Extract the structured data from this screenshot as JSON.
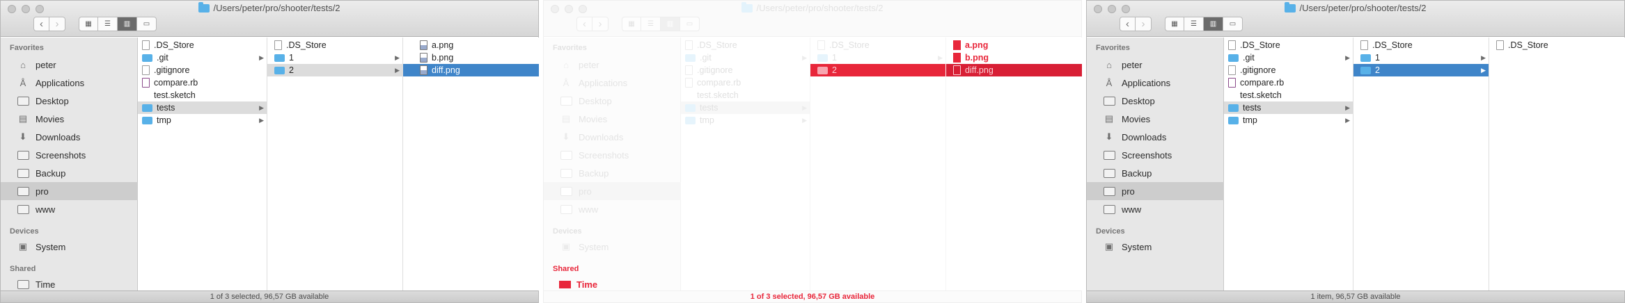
{
  "window": {
    "title": "/Users/peter/pro/shooter/tests/2",
    "nav_back": "‹",
    "nav_forward": "›"
  },
  "sidebar": {
    "favorites_header": "Favorites",
    "favorites": [
      {
        "label": "peter",
        "icon": "home-icon"
      },
      {
        "label": "Applications",
        "icon": "applications-icon"
      },
      {
        "label": "Desktop",
        "icon": "desktop-icon"
      },
      {
        "label": "Movies",
        "icon": "movies-icon"
      },
      {
        "label": "Downloads",
        "icon": "downloads-icon"
      },
      {
        "label": "Screenshots",
        "icon": "folder-icon"
      },
      {
        "label": "Backup",
        "icon": "folder-icon"
      },
      {
        "label": "pro",
        "icon": "folder-icon"
      },
      {
        "label": "www",
        "icon": "folder-icon"
      }
    ],
    "devices_header": "Devices",
    "devices": [
      {
        "label": "System",
        "icon": "disk-icon"
      }
    ],
    "shared_header": "Shared",
    "shared": [
      {
        "label": "Time",
        "icon": "network-icon"
      }
    ]
  },
  "columns": {
    "col1": [
      {
        "name": ".DS_Store",
        "kind": "file"
      },
      {
        "name": ".git",
        "kind": "folder"
      },
      {
        "name": ".gitignore",
        "kind": "file"
      },
      {
        "name": "compare.rb",
        "kind": "ruby"
      },
      {
        "name": "test.sketch",
        "kind": "blank"
      },
      {
        "name": "tests",
        "kind": "folder"
      },
      {
        "name": "tmp",
        "kind": "folder"
      }
    ],
    "col2": [
      {
        "name": ".DS_Store",
        "kind": "file"
      },
      {
        "name": "1",
        "kind": "folder"
      },
      {
        "name": "2",
        "kind": "folder"
      }
    ],
    "col3_left": [
      {
        "name": "a.png"
      },
      {
        "name": "b.png"
      },
      {
        "name": "diff.png"
      }
    ],
    "col3_right": [
      {
        "name": ".DS_Store"
      }
    ]
  },
  "status": {
    "left": "1 of 3 selected, 96,57 GB available",
    "right": "1 item, 96,57 GB available"
  },
  "diff_overlay": {
    "col3": [
      {
        "name": "a.png"
      },
      {
        "name": "b.png"
      },
      {
        "name": "diff.png"
      }
    ],
    "shared_header": "Shared",
    "shared_item": "Time",
    "status": "1 of 3 selected, 96,57 GB available"
  },
  "colors": {
    "selection": "#3f85c9",
    "diff_red": "#e8263a",
    "folder": "#58b1e8"
  }
}
